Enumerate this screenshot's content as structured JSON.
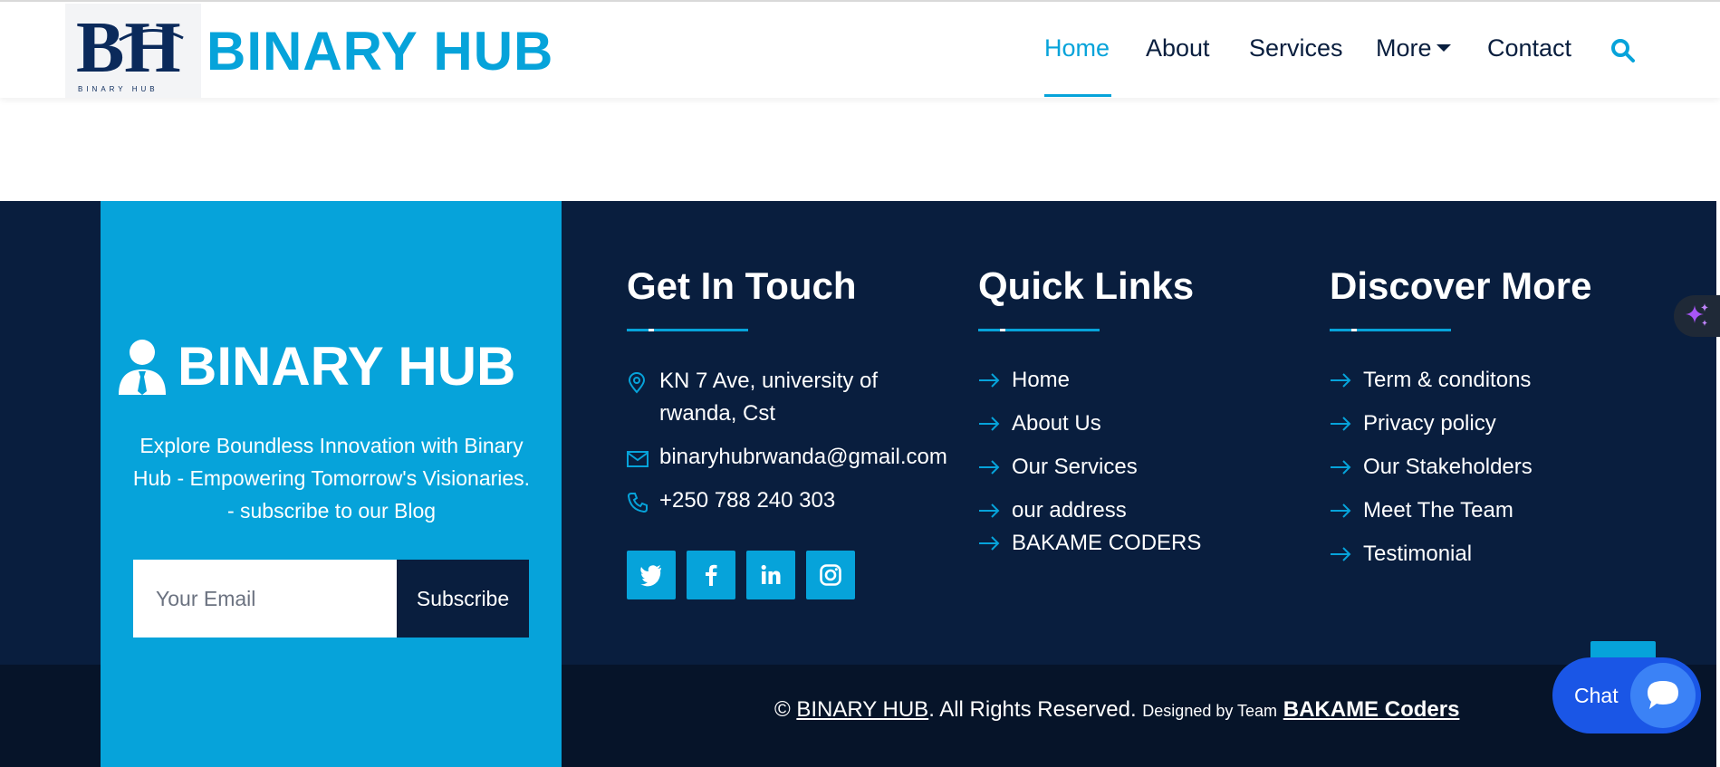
{
  "header": {
    "logo_letters": "BH",
    "logo_caption": "BINARY HUB",
    "brand": "BINARY HUB",
    "nav": [
      {
        "label": "Home",
        "active": true
      },
      {
        "label": "About"
      },
      {
        "label": "Services"
      },
      {
        "label": "More",
        "dropdown": true
      },
      {
        "label": "Contact"
      }
    ],
    "search_icon": "search-icon"
  },
  "footer": {
    "about": {
      "brand": "BINARY HUB",
      "brand_icon": "user-tie-icon",
      "description": "Explore Boundless Innovation with Binary Hub - Empowering Tomorrow's Visionaries. - subscribe to our Blog",
      "email_placeholder": "Your Email",
      "subscribe_label": "Subscribe"
    },
    "get_in_touch": {
      "title": "Get In Touch",
      "address_line1": "KN 7 Ave, university of",
      "address_line2": "rwanda, Cst",
      "email": "binaryhubrwanda@gmail.com",
      "phone": "+250 788 240 303",
      "social": [
        "twitter-icon",
        "facebook-icon",
        "linkedin-icon",
        "instagram-icon"
      ]
    },
    "quick_links": {
      "title": "Quick Links",
      "items": [
        "Home",
        "About Us",
        "Our Services",
        "our address",
        "BAKAME CODERS"
      ]
    },
    "discover_more": {
      "title": "Discover More",
      "items": [
        "Term & conditons",
        "Privacy policy",
        "Our Stakeholders",
        "Meet The Team",
        "Testimonial"
      ]
    },
    "copyright": {
      "symbol": "©",
      "brand": "BINARY HUB",
      "rights": ". All Rights Reserved.",
      "designed_by": "Designed by Team",
      "team": "BAKAME Coders"
    }
  },
  "widgets": {
    "chat_label": "Chat"
  },
  "colors": {
    "primary": "#06a3da",
    "dark": "#091e3e",
    "darker": "#061429",
    "chat": "#1a56e6"
  }
}
